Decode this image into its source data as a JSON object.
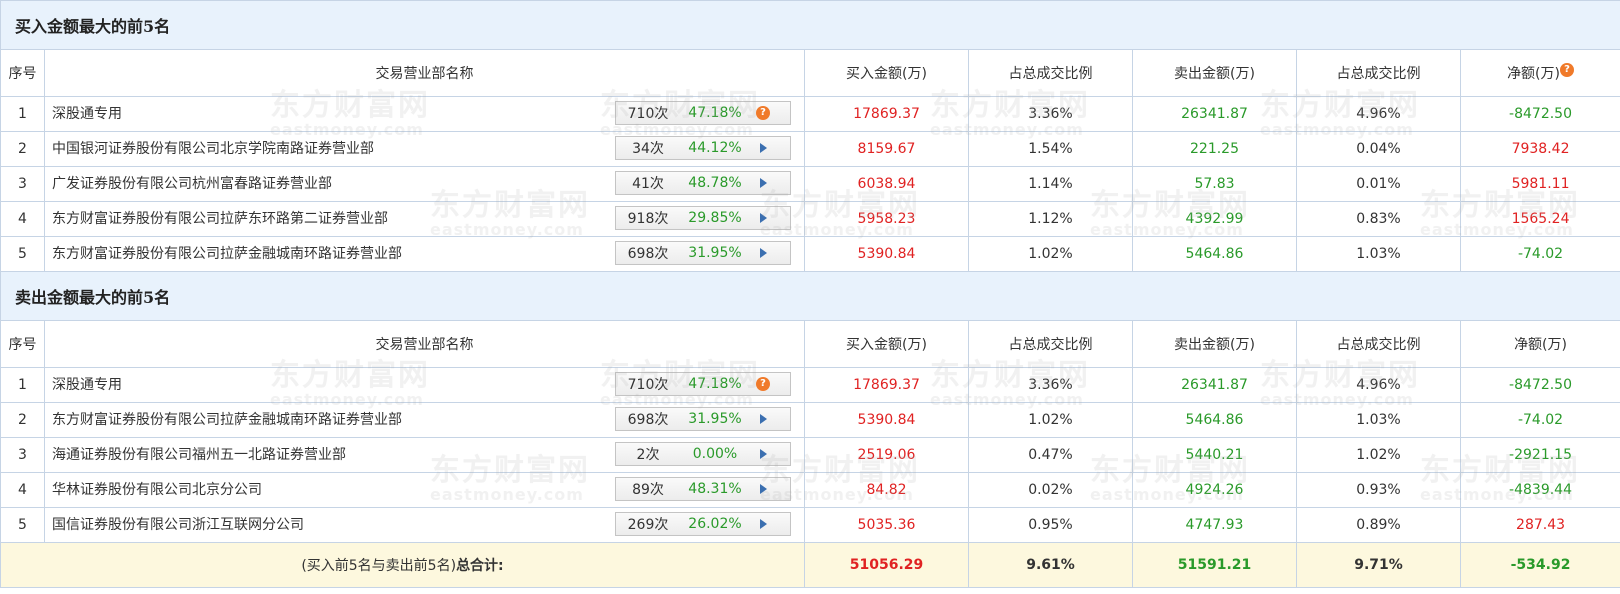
{
  "buy_section": {
    "title": "买入金额最大的前5名",
    "headers": [
      "序号",
      "交易营业部名称",
      "买入金额(万)",
      "占总成交比例",
      "卖出金额(万)",
      "占总成交比例",
      "净额(万)"
    ],
    "rows": [
      {
        "idx": "1",
        "name": "深股通专用",
        "count": "710次",
        "pct": "47.18%",
        "buy": "17869.37",
        "buy_ratio": "3.36%",
        "sell": "26341.87",
        "sell_ratio": "4.96%",
        "net": "-8472.50",
        "net_sign": "neg",
        "badge_icon": "question-icon"
      },
      {
        "idx": "2",
        "name": "中国银河证券股份有限公司北京学院南路证券营业部",
        "count": "34次",
        "pct": "44.12%",
        "buy": "8159.67",
        "buy_ratio": "1.54%",
        "sell": "221.25",
        "sell_ratio": "0.04%",
        "net": "7938.42",
        "net_sign": "pos",
        "badge_icon": "play-arrow-icon"
      },
      {
        "idx": "3",
        "name": "广发证券股份有限公司杭州富春路证券营业部",
        "count": "41次",
        "pct": "48.78%",
        "buy": "6038.94",
        "buy_ratio": "1.14%",
        "sell": "57.83",
        "sell_ratio": "0.01%",
        "net": "5981.11",
        "net_sign": "pos",
        "badge_icon": "play-arrow-icon"
      },
      {
        "idx": "4",
        "name": "东方财富证券股份有限公司拉萨东环路第二证券营业部",
        "count": "918次",
        "pct": "29.85%",
        "buy": "5958.23",
        "buy_ratio": "1.12%",
        "sell": "4392.99",
        "sell_ratio": "0.83%",
        "net": "1565.24",
        "net_sign": "pos",
        "badge_icon": "play-arrow-icon"
      },
      {
        "idx": "5",
        "name": "东方财富证券股份有限公司拉萨金融城南环路证券营业部",
        "count": "698次",
        "pct": "31.95%",
        "buy": "5390.84",
        "buy_ratio": "1.02%",
        "sell": "5464.86",
        "sell_ratio": "1.03%",
        "net": "-74.02",
        "net_sign": "neg",
        "badge_icon": "play-arrow-icon"
      }
    ]
  },
  "sell_section": {
    "title": "卖出金额最大的前5名",
    "headers": [
      "序号",
      "交易营业部名称",
      "买入金额(万)",
      "占总成交比例",
      "卖出金额(万)",
      "占总成交比例",
      "净额(万)"
    ],
    "rows": [
      {
        "idx": "1",
        "name": "深股通专用",
        "count": "710次",
        "pct": "47.18%",
        "buy": "17869.37",
        "buy_ratio": "3.36%",
        "sell": "26341.87",
        "sell_ratio": "4.96%",
        "net": "-8472.50",
        "net_sign": "neg",
        "badge_icon": "question-icon"
      },
      {
        "idx": "2",
        "name": "东方财富证券股份有限公司拉萨金融城南环路证券营业部",
        "count": "698次",
        "pct": "31.95%",
        "buy": "5390.84",
        "buy_ratio": "1.02%",
        "sell": "5464.86",
        "sell_ratio": "1.03%",
        "net": "-74.02",
        "net_sign": "neg",
        "badge_icon": "play-arrow-icon"
      },
      {
        "idx": "3",
        "name": "海通证券股份有限公司福州五一北路证券营业部",
        "count": "2次",
        "pct": "0.00%",
        "buy": "2519.06",
        "buy_ratio": "0.47%",
        "sell": "5440.21",
        "sell_ratio": "1.02%",
        "net": "-2921.15",
        "net_sign": "neg",
        "badge_icon": "play-arrow-icon"
      },
      {
        "idx": "4",
        "name": "华林证券股份有限公司北京分公司",
        "count": "89次",
        "pct": "48.31%",
        "buy": "84.82",
        "buy_ratio": "0.02%",
        "sell": "4924.26",
        "sell_ratio": "0.93%",
        "net": "-4839.44",
        "net_sign": "neg",
        "badge_icon": "play-arrow-icon"
      },
      {
        "idx": "5",
        "name": "国信证券股份有限公司浙江互联网分公司",
        "count": "269次",
        "pct": "26.02%",
        "buy": "5035.36",
        "buy_ratio": "0.95%",
        "sell": "4747.93",
        "sell_ratio": "0.89%",
        "net": "287.43",
        "net_sign": "pos",
        "badge_icon": "play-arrow-icon"
      }
    ]
  },
  "total": {
    "label_prefix": "(买入前5名与卖出前5名)",
    "label_bold": "总合计:",
    "buy": "51056.29",
    "buy_ratio": "9.61%",
    "sell": "51591.21",
    "sell_ratio": "9.71%",
    "net": "-534.92"
  },
  "icons": {
    "question_glyph": "?"
  },
  "colors": {
    "positive": "#e02222",
    "negative": "#2a9a2a",
    "header_bg": "#e8f2fc",
    "total_bg": "#fdf8de"
  },
  "watermark": {
    "cn": "东方财富网",
    "en": "eastmoney.com"
  }
}
